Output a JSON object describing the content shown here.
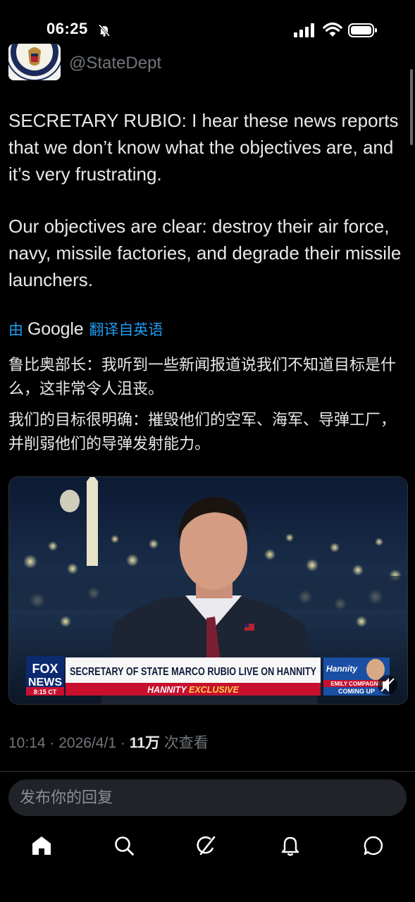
{
  "status_bar": {
    "time": "06:25",
    "icons": [
      "bell-slash-icon",
      "cellular-signal-icon",
      "wifi-icon",
      "battery-icon"
    ]
  },
  "author": {
    "handle": "@StateDept",
    "avatar_icon": "state-department-seal-icon"
  },
  "tweet": {
    "paragraph1": "SECRETARY RUBIO: I hear these news reports that we don’t know what the objectives are, and it’s very frustrating.",
    "paragraph2": "Our objectives are clear: destroy their air force, navy, missile factories, and degrade their missile launchers."
  },
  "translation": {
    "prefix": "由",
    "provider": "Google",
    "link_label": "翻译自英语",
    "paragraph1": "鲁比奥部长：我听到一些新闻报道说我们不知道目标是什么，这非常令人沮丧。",
    "paragraph2": "我们的目标很明确：摧毁他们的空军、海军、导弹工厂，并削弱他们的导弹发射能力。"
  },
  "media": {
    "network": "FOX NEWS",
    "network_top": "FOX",
    "network_bottom": "NEWS",
    "clock": "8:15 CT",
    "headline": "SECRETARY OF STATE MARCO RUBIO LIVE ON HANNITY",
    "subline_show": "HANNITY",
    "subline_tag": "EXCLUSIVE",
    "promo_show": "Hannity",
    "promo_name": "EMILY COMPAGNO",
    "promo_status": "COMING UP"
  },
  "meta": {
    "time": "10:14",
    "separator": "·",
    "date": "2026/4/1",
    "views_count": "11万",
    "views_label": "次查看"
  },
  "reply": {
    "placeholder": "发布你的回复"
  },
  "nav": {
    "items": [
      "home-icon",
      "search-icon",
      "grok-icon",
      "notifications-icon",
      "messages-icon"
    ]
  },
  "colors": {
    "background": "#000000",
    "text": "#e7e9ea",
    "secondary": "#71767b",
    "accent": "#1d9bf0",
    "reply_bg": "#202327"
  }
}
